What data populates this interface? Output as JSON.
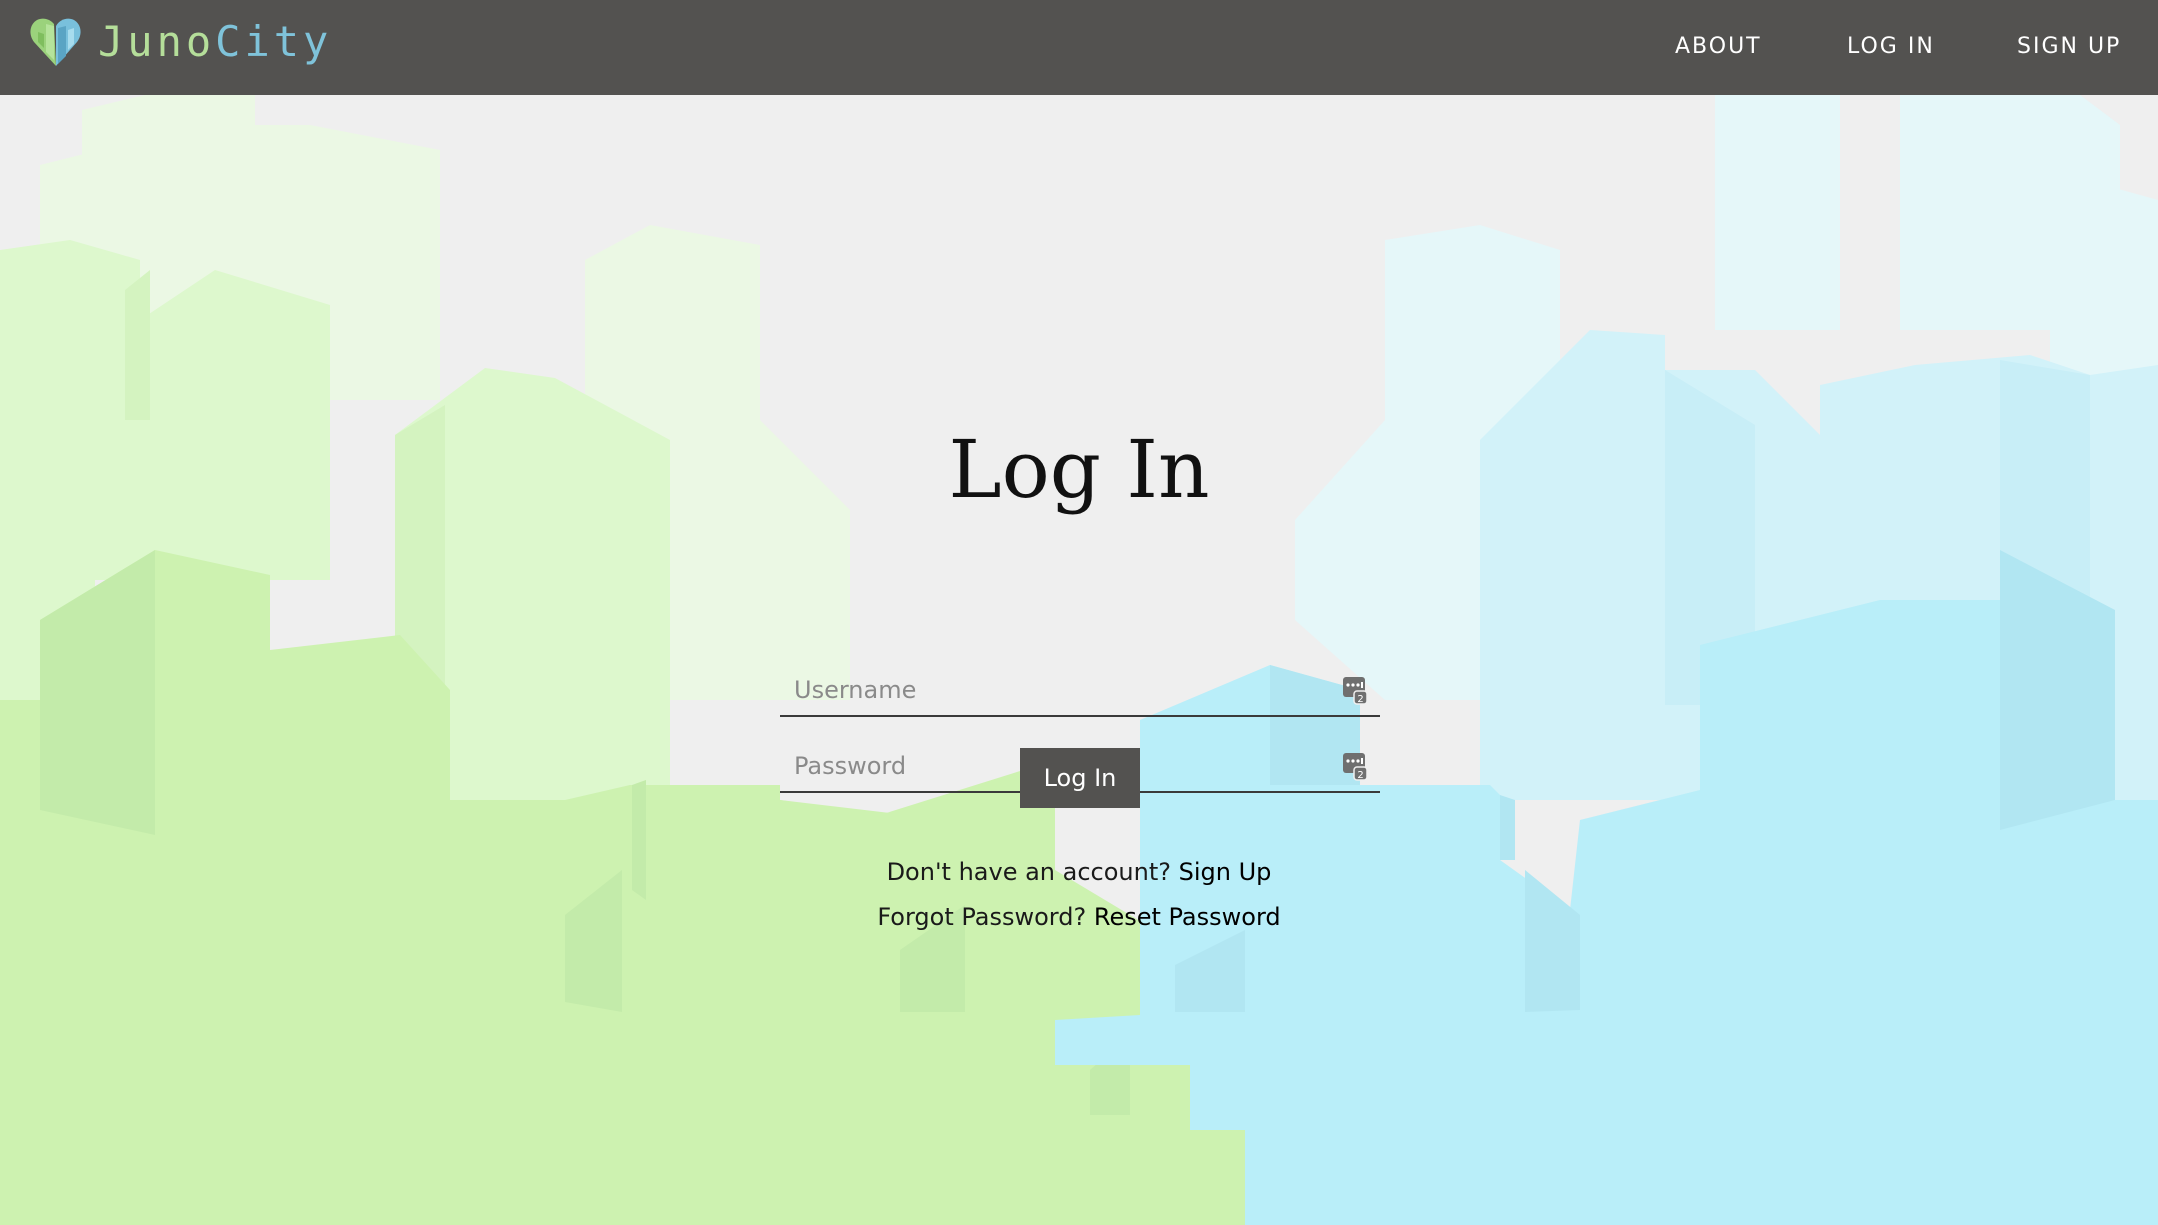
{
  "header": {
    "brand_part1": "Juno",
    "brand_part2": "City",
    "nav": {
      "about": "ABOUT",
      "login": "LOG IN",
      "signup": "SIGN UP"
    }
  },
  "form": {
    "title": "Log In",
    "username_placeholder": "Username",
    "password_placeholder": "Password",
    "username_value": "",
    "password_value": "",
    "submit_label": "Log In",
    "signup_prompt": "Don't have an account?",
    "signup_link": "Sign Up",
    "reset_prompt": "Forgot Password?",
    "reset_link": "Reset Password"
  },
  "colors": {
    "navbar": "#535250",
    "page_background": "#efefef",
    "green_buildings": "#cdf2b0",
    "blue_buildings": "#b9eef9",
    "brand_green": "#b5de9a",
    "brand_blue": "#7fc3da"
  },
  "icons": {
    "logo": "heart-city-logo-icon",
    "field_icon": "password-manager-icon"
  }
}
